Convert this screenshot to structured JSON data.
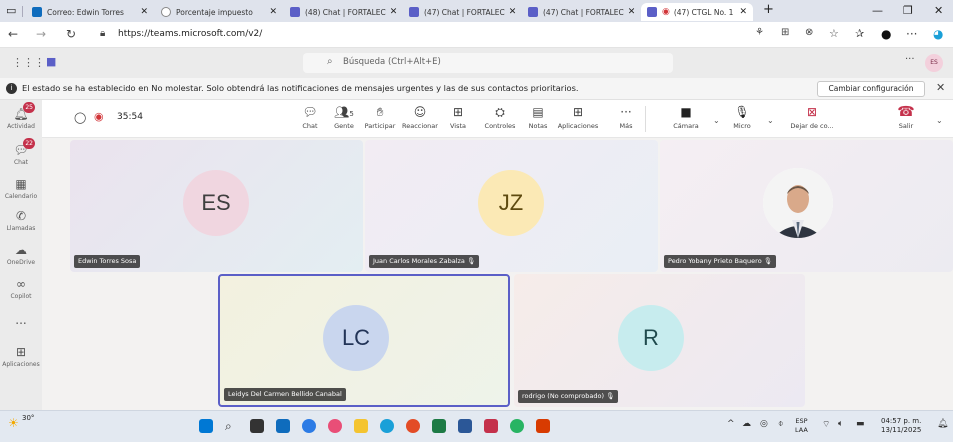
{
  "browser": {
    "tabs": [
      {
        "label": "Correo: Edwin Torres",
        "color": "#0f6cbd"
      },
      {
        "label": "Porcentaje impuesto",
        "color": "#8a8a8a"
      },
      {
        "label": "(48) Chat | FORTALEC",
        "color": "#5b5fc7"
      },
      {
        "label": "(47) Chat | FORTALEC",
        "color": "#5b5fc7"
      },
      {
        "label": "(47) Chat | FORTALEC",
        "color": "#5b5fc7"
      },
      {
        "label": "(47) CTGL No. 1",
        "color": "#5b5fc7"
      }
    ],
    "url": "https://teams.microsoft.com/v2/"
  },
  "teams": {
    "search_placeholder": "Búsqueda (Ctrl+Alt+E)",
    "user_initials": "ES"
  },
  "notification": {
    "text": "El estado se ha establecido en No molestar. Solo obtendrá las notificaciones de mensajes urgentes y las de sus contactos prioritarios.",
    "button": "Cambiar configuración"
  },
  "rail": [
    {
      "label": "Actividad",
      "badge": "25",
      "icon": "bell-icon"
    },
    {
      "label": "Chat",
      "badge": "22",
      "icon": "chat-icon"
    },
    {
      "label": "Calendario",
      "badge": "",
      "icon": "calendar-icon"
    },
    {
      "label": "Llamadas",
      "badge": "",
      "icon": "phone-icon"
    },
    {
      "label": "OneDrive",
      "badge": "",
      "icon": "cloud-icon"
    },
    {
      "label": "Copilot",
      "badge": "",
      "icon": "copilot-icon"
    },
    {
      "label": "...",
      "badge": "",
      "icon": "more-icon"
    },
    {
      "label": "Aplicaciones",
      "badge": "",
      "icon": "apps-icon"
    }
  ],
  "meeting": {
    "timer": "35:54",
    "participants_count": "5",
    "toolbar": [
      {
        "label": "Chat",
        "icon": "chat-icon"
      },
      {
        "label": "Gente",
        "icon": "people-icon"
      },
      {
        "label": "Participar",
        "icon": "raise-hand-icon"
      },
      {
        "label": "Reaccionar",
        "icon": "emoji-icon"
      },
      {
        "label": "Vista",
        "icon": "grid-view-icon"
      },
      {
        "label": "Controles",
        "icon": "controls-icon"
      },
      {
        "label": "Notas",
        "icon": "notes-icon"
      },
      {
        "label": "Aplicaciones",
        "icon": "add-app-icon"
      },
      {
        "label": "Más",
        "icon": "more-icon"
      },
      {
        "label": "Cámara",
        "icon": "camera-off-icon"
      },
      {
        "label": "Micro",
        "icon": "mic-icon"
      },
      {
        "label": "Dejar de co...",
        "icon": "stop-share-icon"
      },
      {
        "label": "Salir",
        "icon": "hang-up-icon"
      }
    ]
  },
  "participants": [
    {
      "initials": "ES",
      "name": "Edwin Torres Sosa",
      "avatar_color": "#f0d6e0",
      "muted": false
    },
    {
      "initials": "JZ",
      "name": "Juan Carlos Morales Zabalza",
      "avatar_color": "#fbe9b5",
      "muted": true
    },
    {
      "initials": "",
      "name": "Pedro Yobany Prieto Baquero",
      "avatar_color": "#ffffff",
      "muted": true
    },
    {
      "initials": "LC",
      "name": "Leidys Del Carmen Bellido Canabal",
      "avatar_color": "#c9d6ee",
      "muted": false
    },
    {
      "initials": "R",
      "name": "rodrigo (No comprobado)",
      "avatar_color": "#c7ecee",
      "muted": true
    }
  ],
  "taskbar": {
    "weather": "30°",
    "lang_top": "ESP",
    "lang_bottom": "LAA",
    "time": "04:57 p. m.",
    "date": "13/11/2025"
  }
}
